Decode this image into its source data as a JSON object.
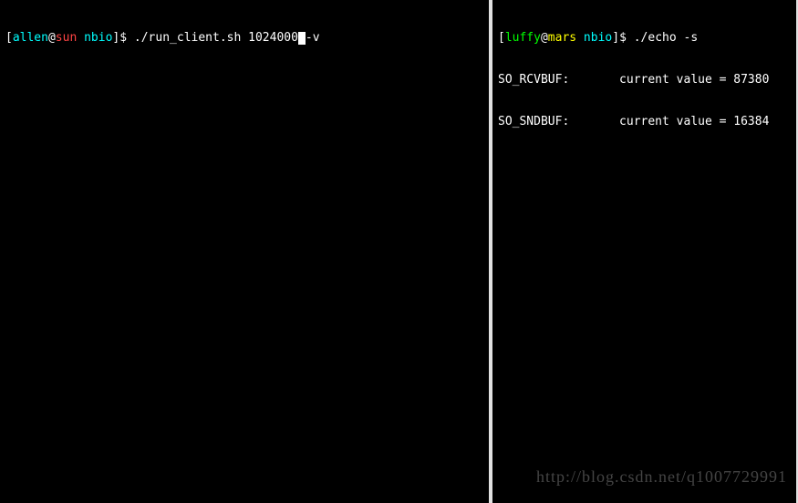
{
  "left_pane": {
    "prompt": {
      "open_bracket": "[",
      "user": "allen",
      "at": "@",
      "host": "sun",
      "dir": " nbio",
      "close_bracket": "]",
      "dollar": "$ "
    },
    "command_before_cursor": "./run_client.sh 1024000",
    "command_after_cursor": "-v"
  },
  "right_pane": {
    "prompt": {
      "open_bracket": "[",
      "user": "luffy",
      "at": "@",
      "host": "mars",
      "dir": " nbio",
      "close_bracket": "]",
      "dollar": "$ "
    },
    "command": "./echo -s",
    "output_lines": [
      "SO_RCVBUF:       current value = 87380",
      "SO_SNDBUF:       current value = 16384"
    ]
  },
  "watermark": "http://blog.csdn.net/q1007729991"
}
